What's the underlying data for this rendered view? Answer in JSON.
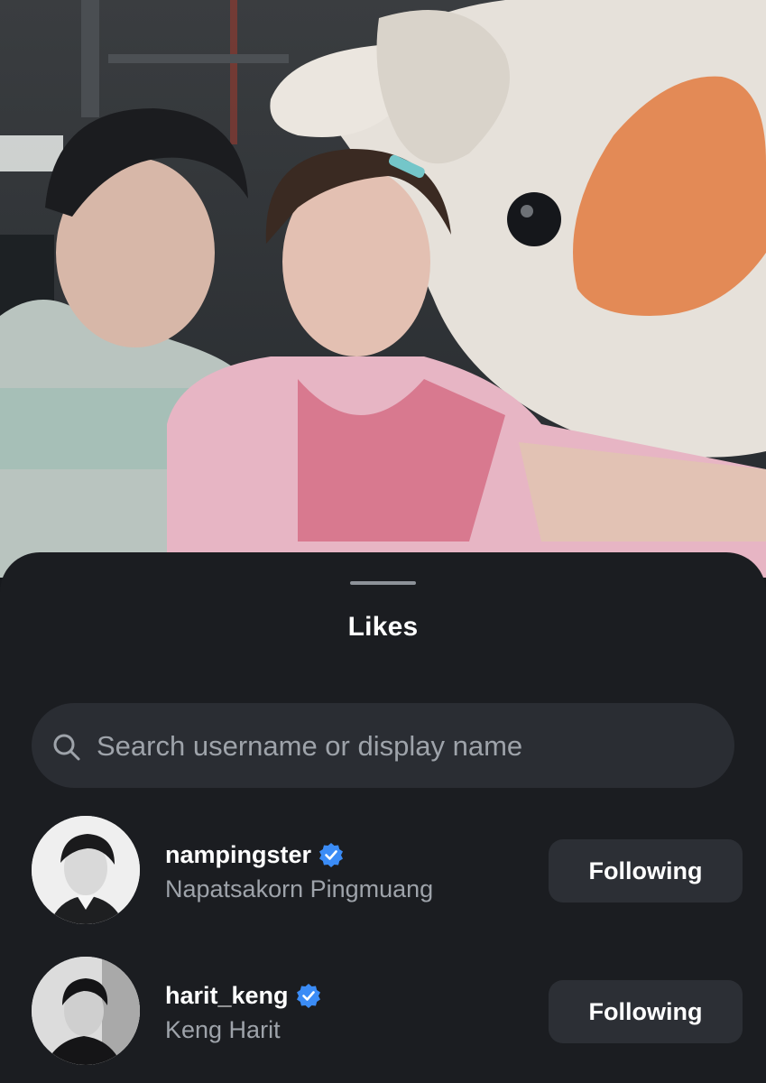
{
  "sheet": {
    "title": "Likes"
  },
  "search": {
    "placeholder": "Search username or display name"
  },
  "users": [
    {
      "username": "nampingster",
      "display_name": "Napatsakorn Pingmuang",
      "verified": true,
      "button_label": "Following"
    },
    {
      "username": "harit_keng",
      "display_name": "Keng Harit",
      "verified": true,
      "button_label": "Following"
    }
  ],
  "icons": {
    "search": "search-icon",
    "verified": "verified-badge-icon",
    "grabber": "drag-handle"
  },
  "colors": {
    "sheet_background": "#1b1d21",
    "search_background": "#2a2d33",
    "button_background": "#2c2f35",
    "verified_blue": "#3b8cf6",
    "secondary_text": "#9ea3aa"
  }
}
